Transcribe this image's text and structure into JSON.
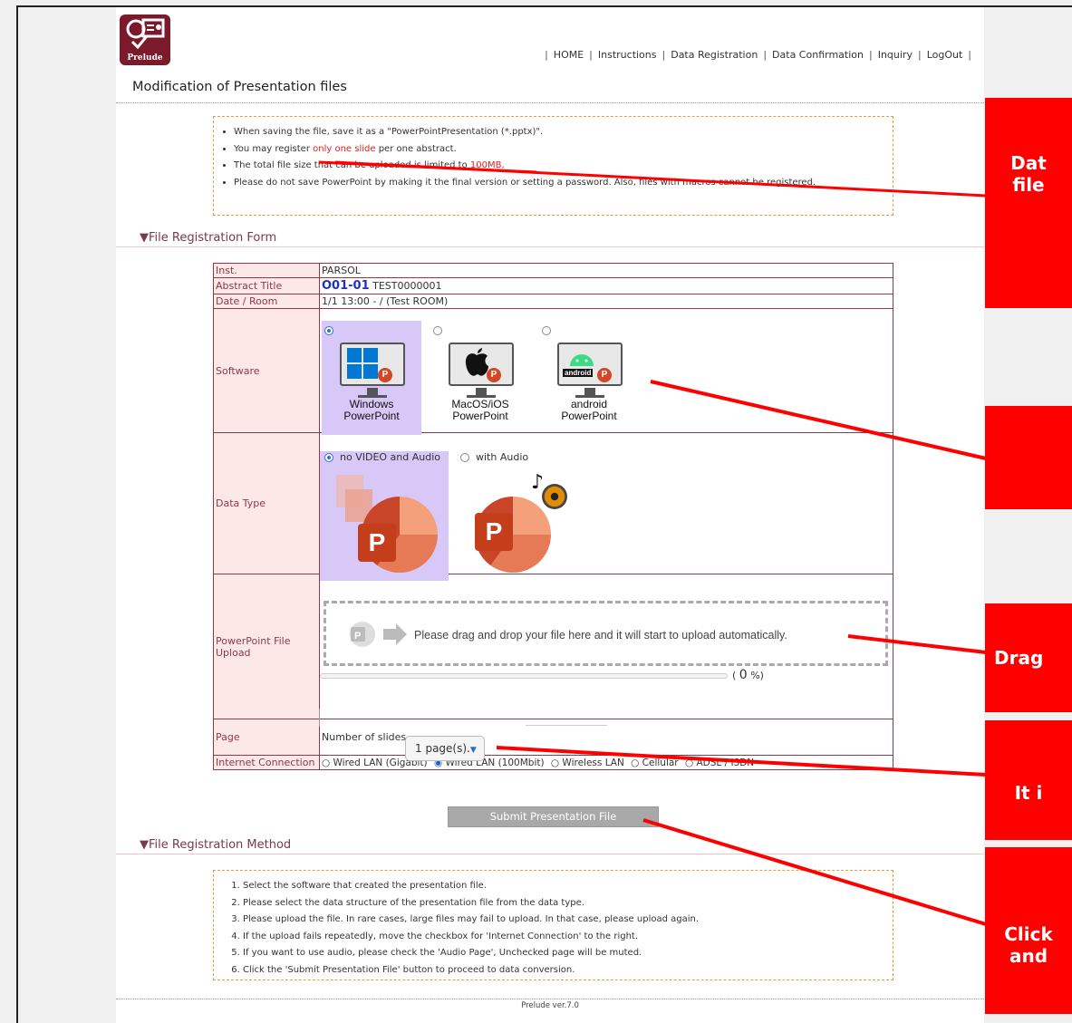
{
  "logo": {
    "text": "Prelude"
  },
  "nav": {
    "items": [
      "HOME",
      "Instructions",
      "Data Registration",
      "Data Confirmation",
      "Inquiry",
      "LogOut"
    ]
  },
  "page_title": "Modification of Presentation files",
  "notes": [
    {
      "before": "When saving the file, save it as a \"PowerPointPresentation (*.pptx)\".",
      "highlight": "",
      "after": ""
    },
    {
      "before": "You may register ",
      "highlight": "only one slide",
      "after": " per one abstract."
    },
    {
      "before": "The total file size that can be uploaded is limited to ",
      "highlight": "100MB,",
      "after": ""
    },
    {
      "before": "Please do not save PowerPoint by making it the final version or setting a password. Also, files with macros cannot be registered.",
      "highlight": "",
      "after": ""
    }
  ],
  "form_section_title": "▼File Registration Form",
  "form": {
    "inst_label": "Inst.",
    "inst_value": "PARSOL",
    "abstract_label": "Abstract Title",
    "abstract_code": "O01-01",
    "abstract_title": "TEST0000001",
    "date_label": "Date / Room",
    "date_value": "1/1 13:00 - / (Test ROOM)",
    "software_label": "Software",
    "software_options": [
      {
        "line1": "Windows",
        "line2": "PowerPoint",
        "selected": true
      },
      {
        "line1": "MacOS/iOS",
        "line2": "PowerPoint",
        "selected": false
      },
      {
        "line1": "android",
        "line2": "PowerPoint",
        "selected": false
      }
    ],
    "android_badge": "android",
    "datatype_label": "Data Type",
    "datatype_options": [
      {
        "label": "no VIDEO and Audio",
        "selected": true
      },
      {
        "label": "with Audio",
        "selected": false
      }
    ],
    "upload_label": "PowerPoint File Upload",
    "upload_hint": "Please drag and drop your file here and it will start to upload automatically.",
    "upload_progress": 0,
    "upload_percent_prefix": "( ",
    "upload_percent_value": "0",
    "upload_percent_suffix": " %)",
    "page_label": "Page",
    "slides_label": "Number of slides",
    "slides_value": "1 page(s).",
    "internet_label": "Internet Connection",
    "internet_options": [
      {
        "label": "Wired LAN (Gigabit)",
        "selected": false
      },
      {
        "label": "Wired LAN (100Mbit)",
        "selected": true
      },
      {
        "label": "Wireless LAN",
        "selected": false
      },
      {
        "label": "Cellular",
        "selected": false
      },
      {
        "label": "ADSL / ISDN",
        "selected": false
      }
    ]
  },
  "submit_label": "Submit Presentation File",
  "method_section_title": "▼File Registration Method",
  "method_steps": [
    "Select the software that created the presentation file.",
    "Please select the data structure of the presentation file from the data type.",
    "Please upload the file. In rare cases, large files may fail to upload. In that case, please upload again.",
    "If the upload fails repeatedly, move the checkbox for 'Internet Connection' to the right.",
    "If you want to use audio, please check the 'Audio Page', Unchecked page will be muted.",
    "Click the 'Submit Presentation File' button to proceed to data conversion."
  ],
  "footer": "Prelude ver.7.0",
  "callouts": [
    {
      "line1": "Dat",
      "line2": "file"
    },
    {
      "line1": "",
      "line2": ""
    },
    {
      "line1": "Drag",
      "line2": ""
    },
    {
      "line1": "It i",
      "line2": ""
    },
    {
      "line1": "Click",
      "line2": "and"
    }
  ],
  "colors": {
    "callout": "#ff0000",
    "selected_bg": "#d8c8f8",
    "header_cell_bg": "#fde8e8",
    "border": "#8b3a4a",
    "highlight_text": "#e02020"
  }
}
